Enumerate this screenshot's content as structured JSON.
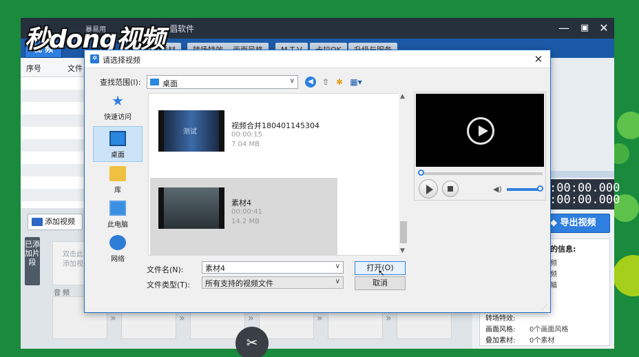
{
  "app": {
    "menu_small": "暴易用",
    "title": "倡软件",
    "logo": "秒dong视频",
    "active_tab": "视 频",
    "tabs": [
      "加素材",
      "转场特效",
      "画面风格",
      "M T V",
      "卡拉OK",
      "升级与服务"
    ],
    "list_headers": [
      "序号",
      "文件"
    ],
    "add_video": "添加视频",
    "side_label": "已添加片段",
    "clip_placeholder": "双击此\n添加视",
    "audio_label": "音频",
    "timecode_1": ":00:00.000",
    "timecode_2": ":00:00.000",
    "export": "导出视频",
    "info_title": "的信息:",
    "info_fragments": [
      "频",
      "频",
      "幅"
    ],
    "info_rows": [
      {
        "label": "转场特效:",
        "value": ""
      },
      {
        "label": "画面风格:",
        "value": "0个画面风格"
      },
      {
        "label": "叠加素材:",
        "value": "0个素材"
      }
    ]
  },
  "dialog": {
    "title": "请选择视频",
    "look_in_label": "查找范围(I):",
    "look_in_value": "桌面",
    "places": [
      "快速访问",
      "桌面",
      "库",
      "此电脑",
      "网络"
    ],
    "files": [
      {
        "name": "视频合并180401145304",
        "duration": "00:00:15",
        "size": "7.04 MB",
        "thumb_caption": "测试"
      },
      {
        "name": "素材4",
        "duration": "00:00:41",
        "size": "14.2 MB",
        "thumb_caption": ""
      }
    ],
    "file_name_label": "文件名(N):",
    "file_name_value": "素材4",
    "file_type_label": "文件类型(T):",
    "file_type_value": "所有支持的视频文件",
    "open_button": "打开(O)",
    "cancel_button": "取消"
  }
}
